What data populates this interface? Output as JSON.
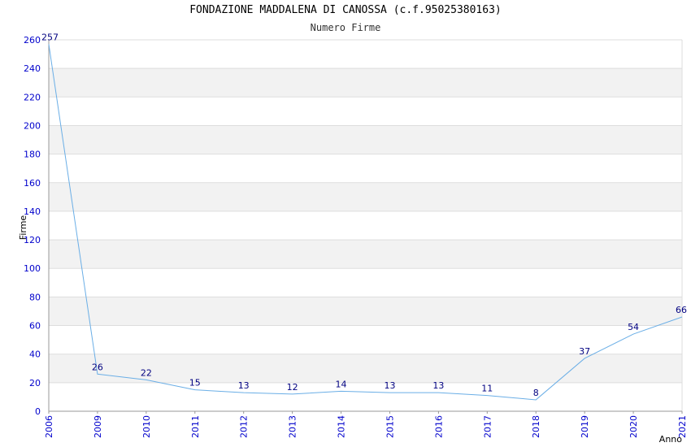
{
  "title": "FONDAZIONE MADDALENA DI CANOSSA (c.f.95025380163)",
  "subtitle": "Numero Firme",
  "chart_data": {
    "type": "line",
    "title": "FONDAZIONE MADDALENA DI CANOSSA (c.f.95025380163)",
    "subtitle": "Numero Firme",
    "xlabel": "Anno",
    "ylabel": "Firme",
    "x": [
      "2006",
      "2009",
      "2010",
      "2011",
      "2012",
      "2013",
      "2014",
      "2015",
      "2016",
      "2017",
      "2018",
      "2019",
      "2020",
      "2021"
    ],
    "values": [
      257,
      26,
      22,
      15,
      13,
      12,
      14,
      13,
      13,
      11,
      8,
      37,
      54,
      66
    ],
    "yticks": [
      0,
      20,
      40,
      60,
      80,
      100,
      120,
      140,
      160,
      180,
      200,
      220,
      240,
      260
    ],
    "ylim": [
      0,
      260
    ],
    "grid": true,
    "line_color": "#6aaee6",
    "label_color": "#000080",
    "tick_color": "#0000cc",
    "band_color": "#f2f2f2"
  }
}
